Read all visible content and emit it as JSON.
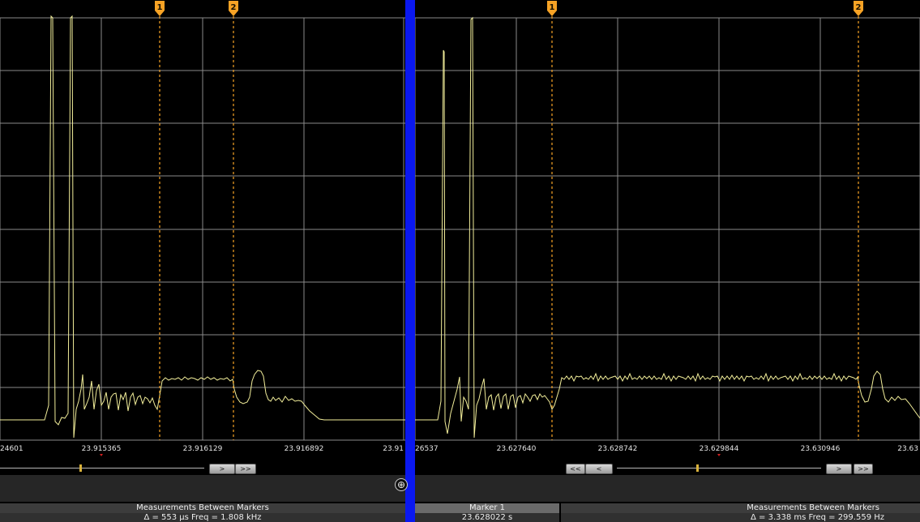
{
  "left": {
    "x_ticks": [
      "24601",
      "23.915365",
      "23.916129",
      "23.916892",
      "23.91"
    ],
    "markers": [
      "1",
      "2"
    ],
    "buttons": {
      "next": ">",
      "end": ">>"
    },
    "measure": {
      "title": "Measurements Between Markers",
      "value": "Δ = 553 µs   Freq = 1.808 kHz"
    }
  },
  "right": {
    "x_ticks": [
      "26537",
      "23.627640",
      "23.628742",
      "23.629844",
      "23.630946",
      "23.63"
    ],
    "markers": [
      "1",
      "2"
    ],
    "buttons": {
      "start": "<<",
      "prev": "<",
      "next": ">",
      "end": ">>"
    },
    "marker1": {
      "title": "Marker 1",
      "value": "23.628022 s"
    },
    "measure": {
      "title": "Measurements Between Markers",
      "value": "Δ = 3.338 ms   Freq = 299.559 Hz"
    }
  },
  "colors": {
    "trace": "#f2ee9a",
    "marker": "#f7a325",
    "grid": "#8a8a8a",
    "divider": "#0a18f0"
  },
  "icons": {
    "zoom": "crosshair-circle-icon"
  }
}
